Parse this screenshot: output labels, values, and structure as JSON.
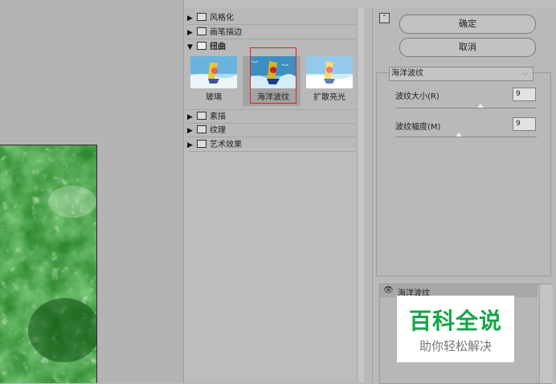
{
  "gallery": {
    "folders": [
      {
        "label": "风格化",
        "expanded": false
      },
      {
        "label": "画笔描边",
        "expanded": false
      },
      {
        "label": "扭曲",
        "expanded": true
      },
      {
        "label": "素描",
        "expanded": false
      },
      {
        "label": "纹理",
        "expanded": false
      },
      {
        "label": "艺术效果",
        "expanded": false
      }
    ],
    "thumbnails": [
      {
        "label": "玻璃",
        "selected": false
      },
      {
        "label": "海洋波纹",
        "selected": true
      },
      {
        "label": "扩散亮光",
        "selected": false
      }
    ]
  },
  "buttons": {
    "ok_label": "确定",
    "cancel_label": "取消"
  },
  "filter": {
    "selected": "海洋波纹",
    "params": [
      {
        "label": "波纹大小(R)",
        "value": "9",
        "slider_fraction": 0.6
      },
      {
        "label": "波纹幅度(M)",
        "value": "9",
        "slider_fraction": 0.45
      }
    ]
  },
  "layers": {
    "items": [
      {
        "label": "海洋波纹",
        "visible": true
      }
    ]
  },
  "watermark": {
    "title": "百科全说",
    "subtitle": "助你轻松解决"
  },
  "colors": {
    "accent_red": "#e01e1e",
    "watermark_green": "#15a54a",
    "preview_green": "#2f8a2f"
  },
  "icons": {
    "collapse": "double-chevron-up-icon",
    "eye": "eye-icon",
    "folder": "folder-icon"
  }
}
